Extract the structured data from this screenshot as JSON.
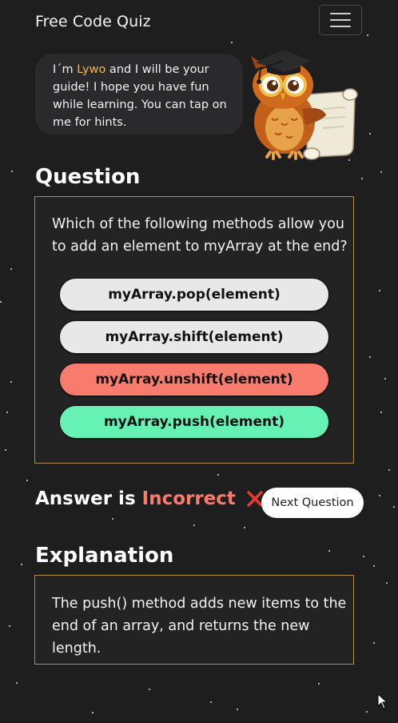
{
  "header": {
    "brand": "Free Code Quiz"
  },
  "icons": {
    "menu": "hamburger-menu-icon",
    "owl": "owl-guide-icon",
    "result": "cross-mark-icon"
  },
  "guide": {
    "intro_before_name": "I´m ",
    "name": "Lywo",
    "intro_after_name": " and I will be your guide! I hope you have fun while learning. You can tap on me for hints."
  },
  "question": {
    "heading": "Question",
    "text": "Which of the following methods allow you to add an element to myArray at the end?",
    "options": [
      {
        "label": "myArray.pop(element)",
        "state": "neutral"
      },
      {
        "label": "myArray.shift(element)",
        "state": "neutral"
      },
      {
        "label": "myArray.unshift(element)",
        "state": "incorrect"
      },
      {
        "label": "myArray.push(element)",
        "state": "correct"
      }
    ]
  },
  "result": {
    "prefix": "Answer is",
    "status": "Incorrect",
    "next_button": "Next Question"
  },
  "explanation": {
    "heading": "Explanation",
    "text": "The push() method adds new items to the end of an array, and returns the new length."
  },
  "colors": {
    "background": "#1e1e1f",
    "accent_gold": "#f0b54a",
    "card_border": "#b38a45",
    "incorrect": "#f87c6d",
    "correct": "#66f2b5",
    "neutral_option": "#e8e8e8"
  }
}
